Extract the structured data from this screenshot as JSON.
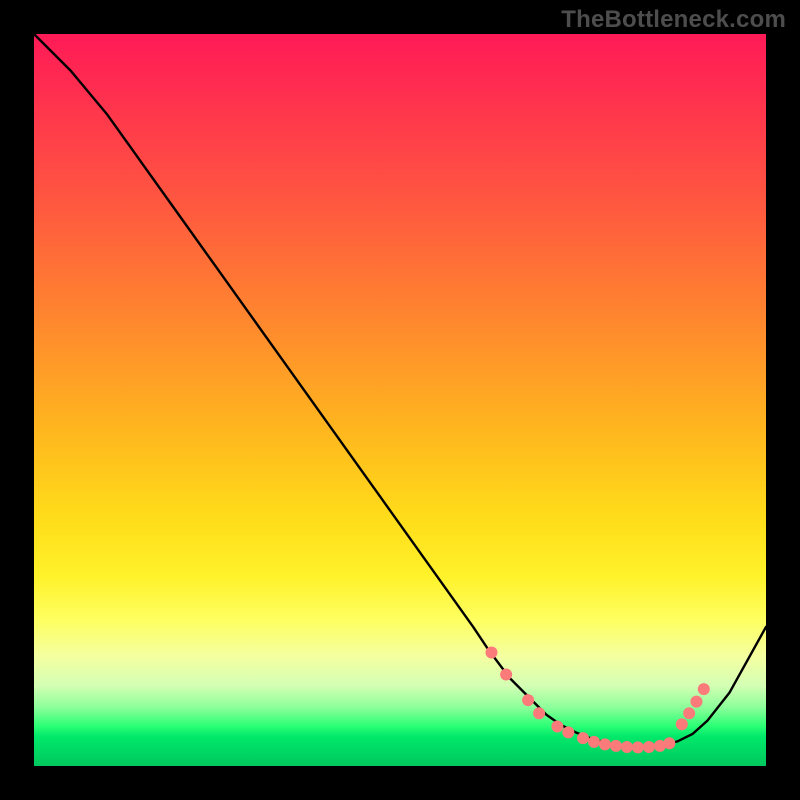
{
  "watermark": "TheBottleneck.com",
  "chart_data": {
    "type": "line",
    "title": "",
    "xlabel": "",
    "ylabel": "",
    "xlim": [
      0,
      100
    ],
    "ylim": [
      0,
      100
    ],
    "grid": false,
    "series": [
      {
        "name": "curve",
        "x": [
          0,
          5,
          10,
          15,
          20,
          25,
          30,
          35,
          40,
          45,
          50,
          55,
          60,
          62,
          65,
          68,
          70,
          72,
          74,
          76,
          78,
          80,
          82,
          84,
          86,
          88,
          90,
          92,
          95,
          100
        ],
        "y": [
          100,
          95,
          89,
          82,
          75,
          68,
          61,
          54,
          47,
          40,
          33,
          26,
          19,
          16,
          12,
          9,
          7,
          5.6,
          4.6,
          3.8,
          3.2,
          2.8,
          2.6,
          2.6,
          2.8,
          3.4,
          4.4,
          6.2,
          10,
          19
        ]
      }
    ],
    "markers": [
      {
        "x": 62.5,
        "y": 15.5
      },
      {
        "x": 64.5,
        "y": 12.5
      },
      {
        "x": 67.5,
        "y": 9.0
      },
      {
        "x": 69.0,
        "y": 7.2
      },
      {
        "x": 71.5,
        "y": 5.4
      },
      {
        "x": 73.0,
        "y": 4.6
      },
      {
        "x": 75.0,
        "y": 3.8
      },
      {
        "x": 76.5,
        "y": 3.3
      },
      {
        "x": 78.0,
        "y": 2.95
      },
      {
        "x": 79.5,
        "y": 2.75
      },
      {
        "x": 81.0,
        "y": 2.6
      },
      {
        "x": 82.5,
        "y": 2.55
      },
      {
        "x": 84.0,
        "y": 2.6
      },
      {
        "x": 85.5,
        "y": 2.75
      },
      {
        "x": 86.8,
        "y": 3.1
      },
      {
        "x": 88.5,
        "y": 5.7
      },
      {
        "x": 89.5,
        "y": 7.2
      },
      {
        "x": 90.5,
        "y": 8.8
      },
      {
        "x": 91.5,
        "y": 10.5
      }
    ],
    "marker_color": "#fb7a7a",
    "marker_radius": 6
  }
}
